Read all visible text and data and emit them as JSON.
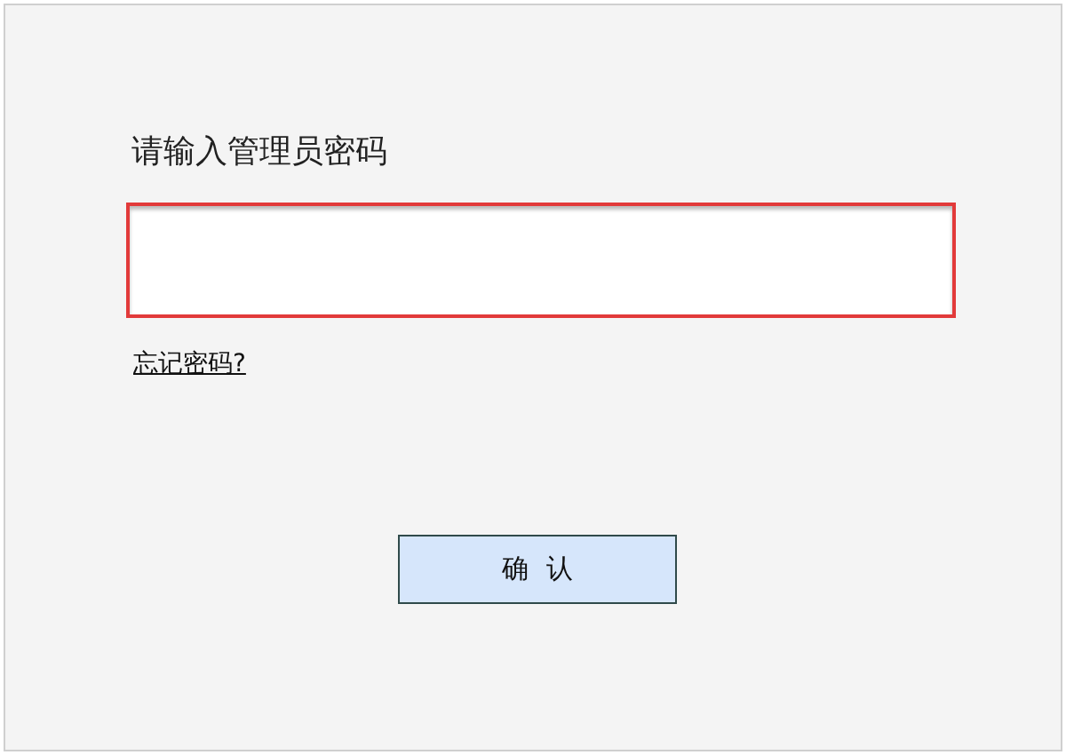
{
  "prompt": "请输入管理员密码",
  "password_field": {
    "highlighted": true
  },
  "forgot_link": "忘记密码?",
  "confirm_button": "确  认"
}
